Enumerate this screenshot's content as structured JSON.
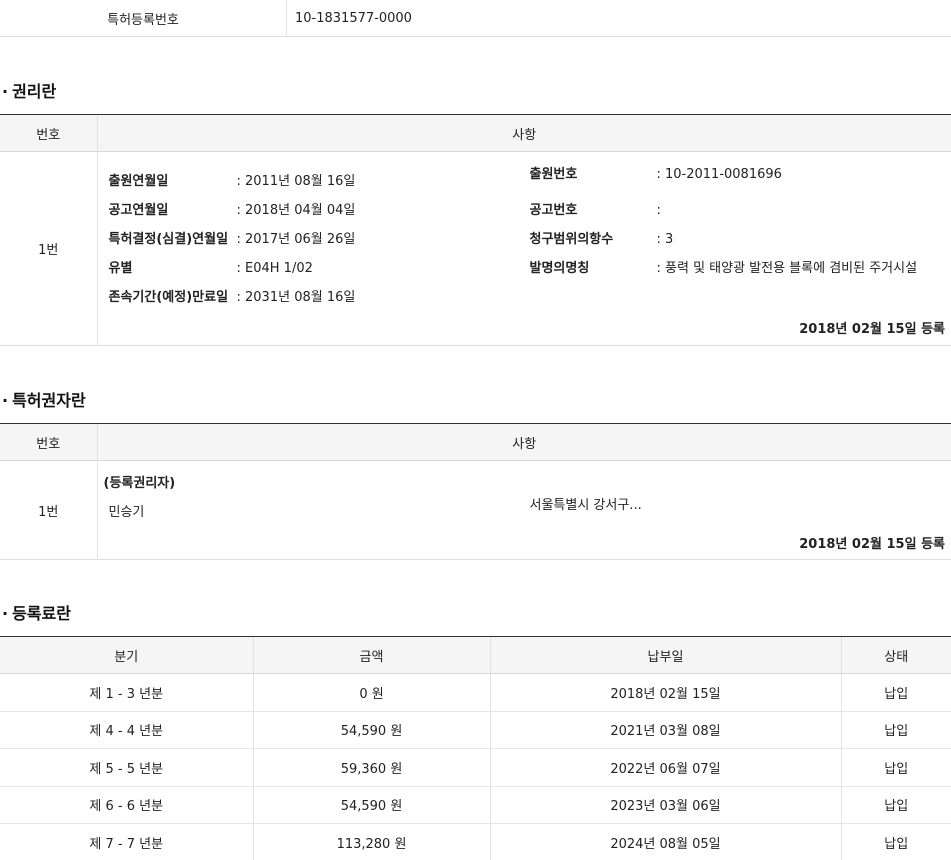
{
  "patent": {
    "label": "특허등록번호",
    "value": "10-1831577-0000"
  },
  "rights_section": {
    "title": "권리란",
    "col_num": "번호",
    "col_detail": "사항",
    "row": {
      "num": "1번",
      "left": [
        {
          "k": "출원연월일",
          "v": ": 2011년 08월 16일"
        },
        {
          "k": "공고연월일",
          "v": ": 2018년 04월 04일"
        },
        {
          "k": "특허결정(심결)연월일",
          "v": ": 2017년 06월 26일"
        },
        {
          "k": "유별",
          "v": ": E04H 1/02"
        },
        {
          "k": "존속기간(예정)만료일",
          "v": ": 2031년 08월 16일"
        }
      ],
      "right": [
        {
          "k": "출원번호",
          "v": ": 10-2011-0081696"
        },
        {
          "k": "공고번호",
          "v": ":"
        },
        {
          "k": "청구범위의항수",
          "v": ": 3"
        },
        {
          "k": "발명의명칭",
          "v": ": 풍력 및 태양광 발전용 블록에 겸비된 주거시설"
        }
      ],
      "registered": "2018년 02월 15일 등록"
    }
  },
  "owners_section": {
    "title": "특허권자란",
    "col_num": "번호",
    "col_detail": "사항",
    "row": {
      "num": "1번",
      "role": "(등록권리자)",
      "name": "민승기",
      "address": "서울특별시 강서구...",
      "registered": "2018년 02월 15일 등록"
    }
  },
  "fees_section": {
    "title": "등록료란",
    "headers": [
      "분기",
      "금액",
      "납부일",
      "상태"
    ],
    "rows": [
      [
        "제 1 - 3 년분",
        "0 원",
        "2018년 02월 15일",
        "납입"
      ],
      [
        "제 4 - 4 년분",
        "54,590 원",
        "2021년 03월 08일",
        "납입"
      ],
      [
        "제 5 - 5 년분",
        "59,360 원",
        "2022년 06월 07일",
        "납입"
      ],
      [
        "제 6 - 6 년분",
        "54,590 원",
        "2023년 03월 06일",
        "납입"
      ],
      [
        "제 7 - 7 년분",
        "113,280 원",
        "2024년 08월 05일",
        "납입"
      ]
    ]
  }
}
